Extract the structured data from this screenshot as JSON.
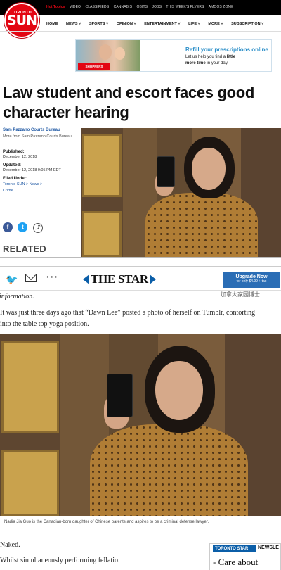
{
  "sun": {
    "top_links": [
      "Hot Topics",
      "VIDEO",
      "CLASSIFIEDS",
      "CANNABIS",
      "OBITS",
      "JOBS",
      "THIS WEEK'S FLYERS",
      "AMOOS ZONE"
    ],
    "logo_small": "TORONTO",
    "logo_word": "SUN",
    "nav": [
      "HOME",
      "NEWS ˅",
      "SPORTS ˅",
      "OPINION ˅",
      "ENTERTAINMENT ˅",
      "LIFE ˅",
      "MORE ˅",
      "SUBSCRIPTION ˅"
    ],
    "ad": {
      "brand": "SHOPPERS",
      "headline": "Refill your prescriptions online",
      "line1_pre": "Let us help you find a ",
      "line1_bold": "little",
      "line2_bold": "more time",
      "line2_post": " in your day."
    },
    "headline": "Law student and escort faces good character hearing",
    "byline": "Sam Pazzano Courts Bureau",
    "more_from": "More from Sam Pazzano Courts Bureau",
    "published_label": "Published:",
    "published_value": "December 12, 2018",
    "updated_label": "Updated:",
    "updated_value": "December 12, 2018 9:05 PM EDT",
    "filed_label": "Filed Under:",
    "filed_path": "Toronto SUN  >  News  >",
    "filed_section": "Crime",
    "social_icons": [
      "facebook-icon",
      "twitter-icon",
      "share-icon"
    ],
    "related": "RELATED"
  },
  "star": {
    "logo": "THE STAR",
    "upgrade_title": "Upgrade Now",
    "upgrade_sub": "for only $4.99 + tax",
    "line_intro": "information.",
    "para1_line1": "It was just three days ago that “Dawn Lee” posted a photo of herself on Tumblr, contorting",
    "para1_line2": "into the table top yoga position.",
    "caption": "Nadia Jia Guo is the Canadian-born daughter of Chinese parents and aspires to be a criminal defense lawyer.",
    "line_naked": "Naked.",
    "line_whilst": "Whilst simultaneously performing fellatio.",
    "newsletter_head": "TORONTO STAR",
    "newsletter_head2": "NEWSLE",
    "newsletter_body": "- Care about",
    "watermark": "加拿大家园博士"
  },
  "colors": {
    "sun_red": "#e30613",
    "sun_link_blue": "#2059a4",
    "star_blue": "#0b5ea8",
    "upgrade_blue": "#2a6db5"
  }
}
